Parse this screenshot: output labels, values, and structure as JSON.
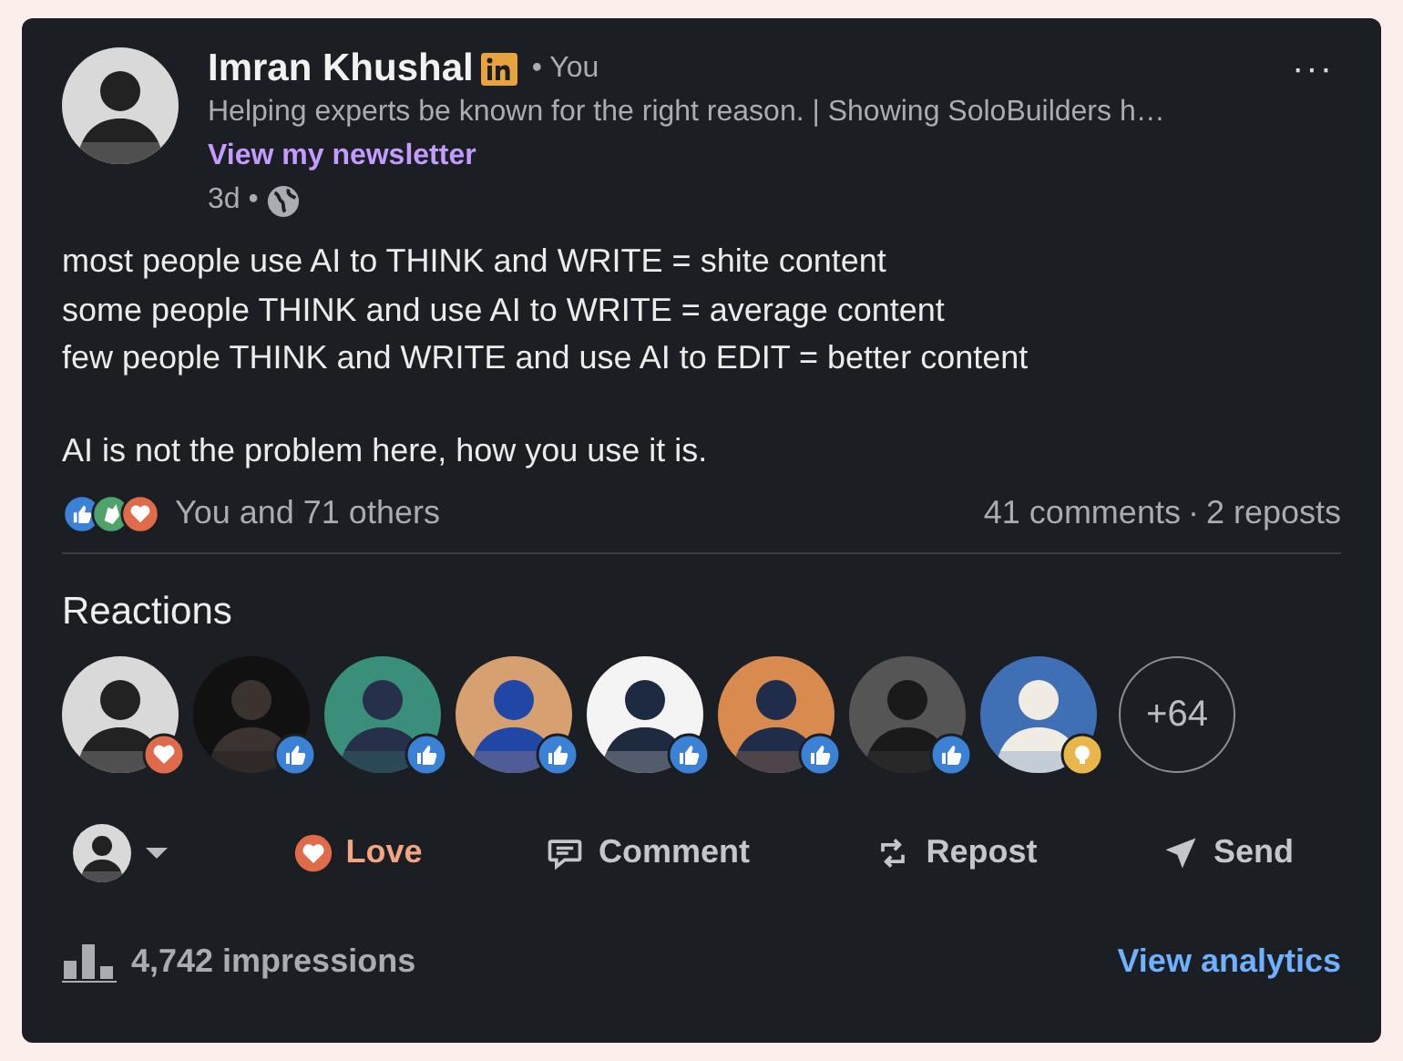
{
  "author": {
    "name": "Imran Khushal",
    "relation": "• You",
    "headline": "Helping experts be known for the right reason. | Showing SoloBuilders h…",
    "newsletter_link": "View my newsletter",
    "age": "3d •"
  },
  "more_button": "···",
  "post_paragraphs": [
    [
      "most people use AI to THINK and WRITE = shite content",
      "some people THINK and use AI to WRITE = average content",
      "few people THINK and WRITE and use AI to EDIT = better content"
    ],
    [
      "AI is not the problem here, how you use it is."
    ]
  ],
  "reaction_summary": {
    "icons": [
      {
        "kind": "like"
      },
      {
        "kind": "clap"
      },
      {
        "kind": "love"
      }
    ],
    "text": "You and 71 others",
    "comments": "41 comments",
    "separator": "·",
    "reposts": "2 reposts"
  },
  "reactions": {
    "title": "Reactions",
    "people": [
      {
        "kind": "love"
      },
      {
        "kind": "like"
      },
      {
        "kind": "like"
      },
      {
        "kind": "like"
      },
      {
        "kind": "like"
      },
      {
        "kind": "like"
      },
      {
        "kind": "like"
      },
      {
        "kind": "insightful"
      }
    ],
    "more": "+64"
  },
  "actions": [
    {
      "kind": "love",
      "label": "Love",
      "selected": true
    },
    {
      "kind": "comment",
      "label": "Comment",
      "selected": false
    },
    {
      "kind": "repost",
      "label": "Repost",
      "selected": false
    },
    {
      "kind": "send",
      "label": "Send",
      "selected": false
    }
  ],
  "footer": {
    "impressions": "4,742 impressions",
    "analytics_link": "View analytics"
  }
}
